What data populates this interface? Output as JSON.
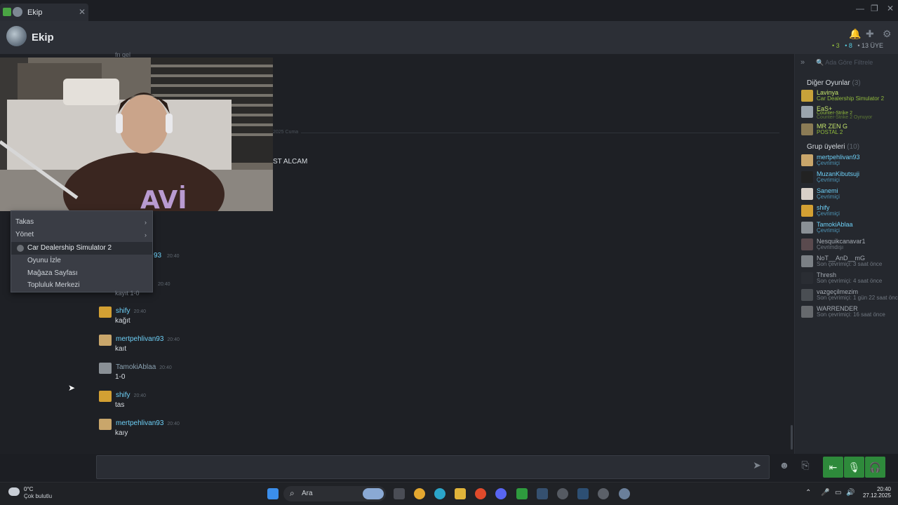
{
  "window": {
    "tab_title": "Ekip",
    "close": "✕",
    "min": "—",
    "max": "❐",
    "x": "✕"
  },
  "header": {
    "group_name": "Ekip",
    "counts": {
      "ingame": "• 3",
      "online": "• 8",
      "members": "• 13 ÜYE"
    }
  },
  "chat": {
    "partial_top": "fn gel",
    "date_divider": "2025 Cuma",
    "partial_msg": "ST ALCAM",
    "messages": [
      {
        "name": "mertpehlivan93",
        "time": "20:40",
        "text": "",
        "partial": "93",
        "av": "#c9a66b"
      },
      {
        "name": "",
        "time": "20:40",
        "text": "kayıt 1-0",
        "av": "#333"
      },
      {
        "name": "shify",
        "time": "20:40",
        "text": "kağıt",
        "av": "#d3a033",
        "color": "online"
      },
      {
        "name": "mertpehlivan93",
        "time": "20:40",
        "text": "kaıt",
        "av": "#c9a66b"
      },
      {
        "name": "TamokiAblaa",
        "time": "20:40",
        "text": "1-0",
        "av": "#8a9096",
        "color": "gray"
      },
      {
        "name": "shify",
        "time": "20:40",
        "text": "tas",
        "av": "#d3a033"
      },
      {
        "name": "mertpehlivan93",
        "time": "20:40",
        "text": "kaıy",
        "av": "#c9a66b"
      }
    ]
  },
  "context_menu": {
    "items": [
      {
        "label": "Takas",
        "arrow": "›"
      },
      {
        "label": "Yönet",
        "arrow": "›"
      },
      {
        "label": "Car Dealership Simulator 2"
      },
      {
        "label": "Oyunu İzle"
      },
      {
        "label": "Mağaza Sayfası"
      },
      {
        "label": "Topluluk Merkezi"
      }
    ]
  },
  "sidebar": {
    "filter_placeholder": "Ada Göre Filtrele",
    "collapse": "»",
    "other_games": {
      "title": "Diğer Oyunlar",
      "count": "(3)"
    },
    "ingame": [
      {
        "name": "Lavinya",
        "status": "Car Dealership Simulator 2",
        "av": "#c8a23a"
      },
      {
        "name": "EaS+",
        "status": "Counter-Strike 2",
        "status2": "Counter-Strike 2 Oynuyor",
        "av": "#9aa4ad"
      },
      {
        "name": "MR ZEN G",
        "status": "POSTAL 2",
        "av": "#8b7b55"
      }
    ],
    "group_members": {
      "title": "Grup üyeleri",
      "count": "(10)"
    },
    "members": [
      {
        "name": "mertpehlivan93",
        "status": "Çevrimiçi",
        "kind": "online",
        "av": "#c9a66b"
      },
      {
        "name": "MuzanKibutsuji",
        "status": "Çevrimiçi",
        "kind": "online",
        "av": "#222"
      },
      {
        "name": "Sanemi",
        "status": "Çevrimiçi",
        "kind": "online",
        "av": "#d8d0c8"
      },
      {
        "name": "shify",
        "status": "Çevrimiçi",
        "kind": "online",
        "av": "#d3a033"
      },
      {
        "name": "TamokiAblaa",
        "status": "Çevrimiçi",
        "kind": "online",
        "av": "#8a9096"
      },
      {
        "name": "Nesquikcanavar1",
        "status": "Çevrimdışı",
        "kind": "offline",
        "av": "#5a4a4e"
      },
      {
        "name": "NoT__AnD__mG",
        "status": "Son çevrimiçi: 3 saat önce",
        "kind": "offline",
        "av": "#7b8085"
      },
      {
        "name": "Thresh",
        "status": "Son çevrimiçi: 4 saat önce",
        "kind": "offline",
        "av": "#2a2d33"
      },
      {
        "name": "vazgeçilmezim",
        "status": "Son çevrimiçi: 1 gün 22 saat önce",
        "kind": "offline",
        "av": "#4a4e53"
      },
      {
        "name": "WARRENDER",
        "status": "Son çevrimiçi: 16 saat önce",
        "kind": "offline",
        "av": "#66696d"
      }
    ]
  },
  "taskbar": {
    "weather_temp": "0°C",
    "weather_desc": "Çok bulutlu",
    "search_label": "Ara",
    "time": "20:40",
    "date": "27.12.2025",
    "apps": [
      "windows-icon",
      "search-icon",
      "widgets-icon",
      "taskview-icon",
      "chrome-icon",
      "edge-icon",
      "explorer-icon",
      "opera-icon",
      "discord-icon",
      "xbox-icon",
      "steam-icon",
      "steam-icon-2",
      "steam-active-icon",
      "settings-icon"
    ]
  }
}
